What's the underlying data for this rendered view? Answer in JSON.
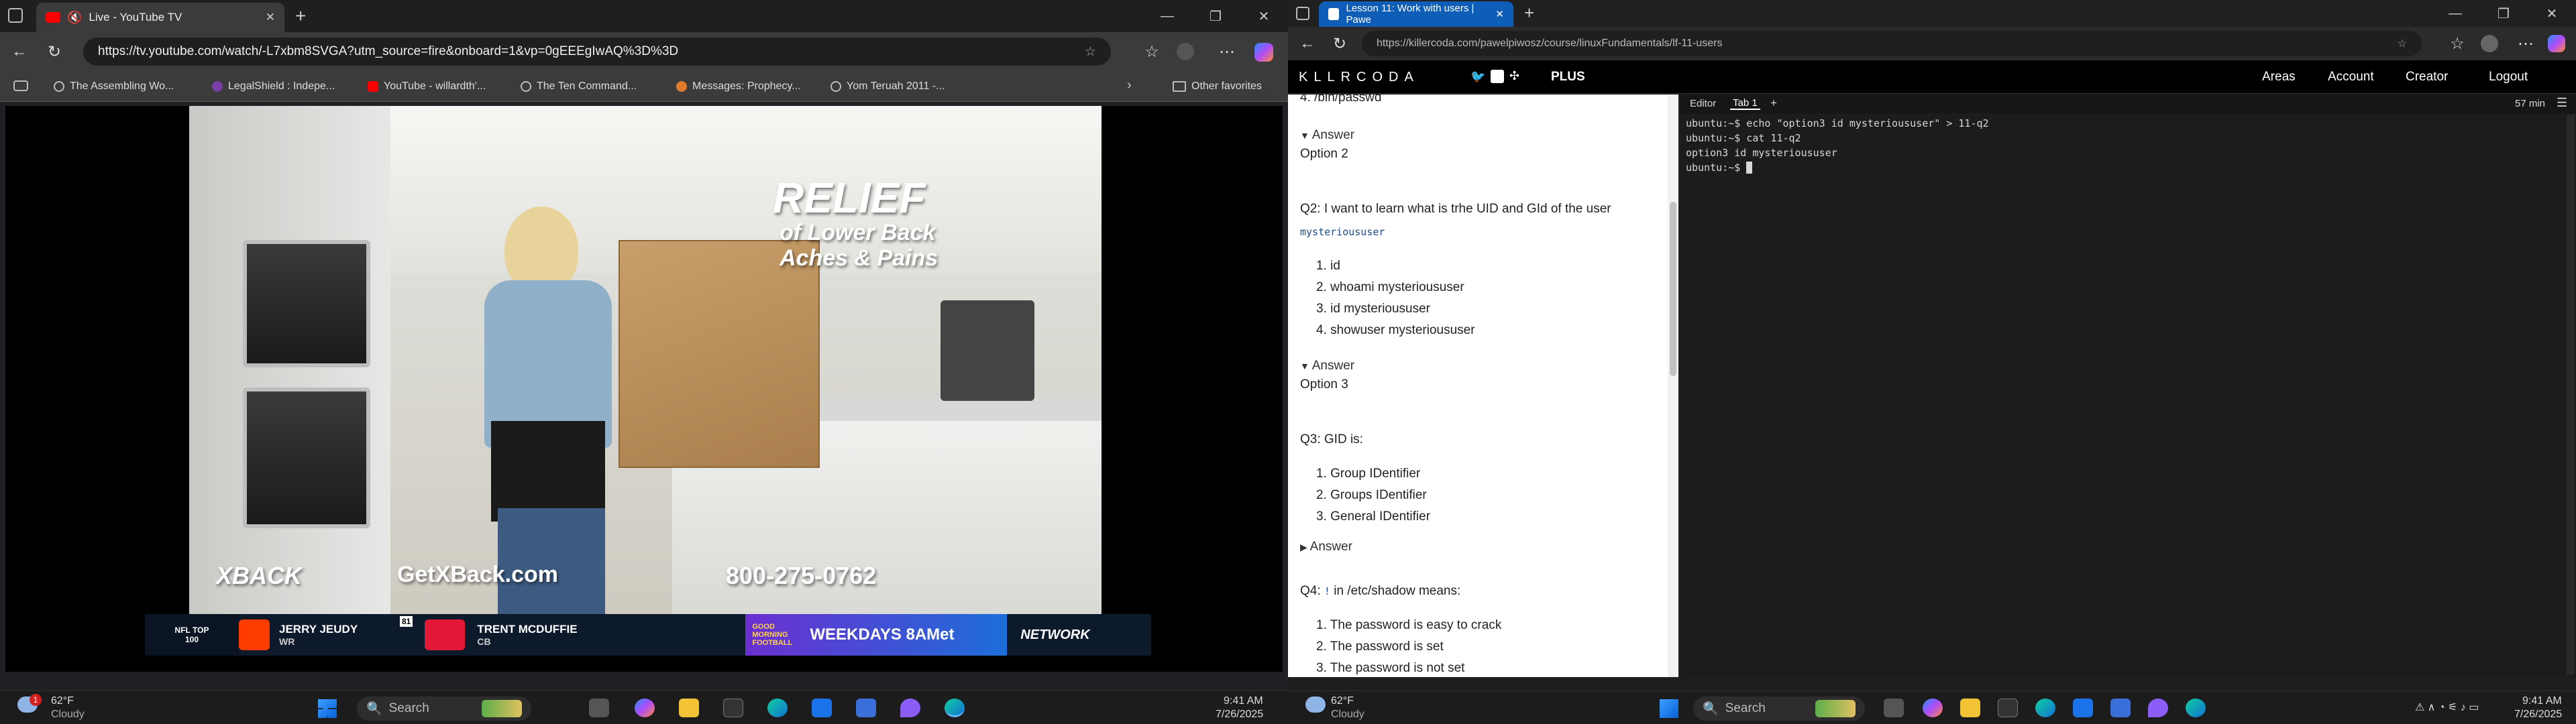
{
  "left_browser": {
    "tab_title": "Live - YouTube TV",
    "url": "https://tv.youtube.com/watch/-L7xbm8SVGA?utm_source=fire&onboard=1&vp=0gEEEgIwAQ%3D%3D",
    "bookmarks": [
      "The Assembling Wo...",
      "LegalShield : Indepe...",
      "YouTube - willardth'...",
      "The Ten Command...",
      "Messages: Prophecy...",
      "Yom Teruah 2011 -..."
    ],
    "other_favorites": "Other favorites"
  },
  "video": {
    "overlay_relief": "RELIEF",
    "overlay_line1": "of Lower Back",
    "overlay_line2": "Aches & Pains",
    "brand": "XBACK",
    "site": "GetXBack.com",
    "phone": "800-275-0762",
    "ticker": {
      "badge": "NFL TOP 100",
      "player1_name": "JERRY JEUDY",
      "player1_pos": "WR",
      "rank": "81",
      "player2_name": "TRENT MCDUFFIE",
      "player2_pos": "CB",
      "show_top": "GOOD MORNING FOOTBALL",
      "show_time": "WEEKDAYS 8AMet",
      "network": "NETWORK"
    }
  },
  "right_browser": {
    "tab_title": "Lesson 11: Work with users | Pawe",
    "url": "https://killercoda.com/pawelpiwosz/course/linuxFundamentals/lf-11-users",
    "nav": {
      "logo": "KLLRCODA",
      "plus": "PLUS",
      "links": [
        "Areas",
        "Account",
        "Creator",
        "Logout"
      ]
    },
    "course": {
      "top_cut": "4. /bin/passwd",
      "answer_label": "Answer",
      "answer1": "Option 2",
      "q2_text": "Q2: I want to learn what is trhe UID and GId of the user",
      "q2_code": "mysterioususer",
      "q2_options": [
        "id",
        "whoami mysterioususer",
        "id mysterioususer",
        "showuser mysterioususer"
      ],
      "answer2": "Option 3",
      "q3_text": "Q3: GID is:",
      "q3_options": [
        "Group IDentifier",
        "Groups IDentifier",
        "General IDentifier"
      ],
      "q4_prefix": "Q4:",
      "q4_code": "!",
      "q4_suffix": "in /etc/shadow means:",
      "q4_options": [
        "The password is easy to crack",
        "The password is set",
        "The password is not set"
      ]
    },
    "terminal": {
      "tabs": [
        "Editor",
        "Tab 1",
        "+"
      ],
      "timer": "57 min",
      "lines": [
        "ubuntu:~$ echo \"option3 id mysterioususer\" > 11-q2",
        "ubuntu:~$ cat 11-q2",
        "option3 id mysterioususer",
        "ubuntu:~$ "
      ]
    }
  },
  "taskbar_left": {
    "weather_temp": "62°F",
    "weather_desc": "Cloudy",
    "search": "Search",
    "time": "9:41 AM",
    "date": "7/26/2025",
    "notification_count": "1"
  },
  "taskbar_right": {
    "weather_temp": "62°F",
    "weather_desc": "Cloudy",
    "search": "Search",
    "time": "9:41 AM",
    "date": "7/26/2025"
  },
  "colors": {
    "accent_blue": "#0e5eb8",
    "yt_red": "#ff0000"
  }
}
